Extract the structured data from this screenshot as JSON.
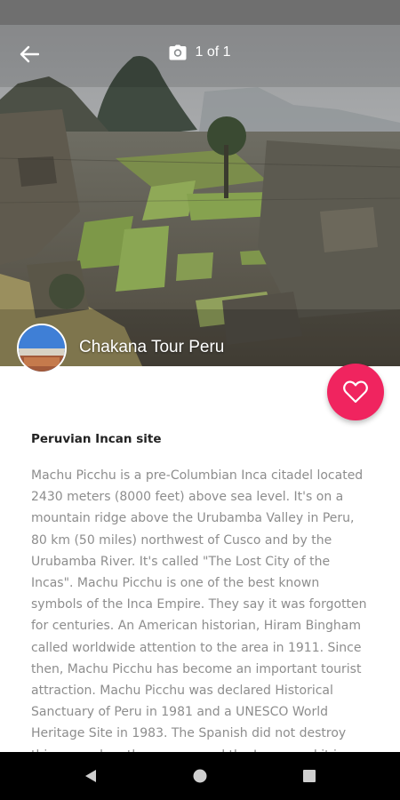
{
  "header": {
    "back_icon": "arrow-left-icon",
    "camera_icon": "camera-icon",
    "photo_counter": "1 of 1"
  },
  "provider": {
    "name": "Chakana Tour Peru"
  },
  "favorite": {
    "icon": "heart-outline-icon",
    "color": "#f0245f"
  },
  "content": {
    "subtitle": "Peruvian Incan site",
    "description": "Machu Picchu is a pre-Columbian Inca citadel located 2430 meters (8000 feet) above sea level. It's on a mountain ridge above the Urubamba Valley in Peru, 80 km (50 miles) northwest of Cusco and by the Urubamba River. It's called \"The Lost City of the Incas\". Machu Picchu is one of the best known symbols of the Inca Empire. They say it was forgotten for centuries. An American historian, Hiram Bingham called worldwide attention to the area in 1911. Since then, Machu Picchu has become an important tourist attraction. Machu Picchu was declared Historical Sanctuary of Peru in 1981 and a UNESCO World Heritage Site in 1983. The Spanish did not destroy this area when they conquered the Incas, and it is possibly the reason it remained"
  },
  "navigation": {
    "back_icon": "triangle-back-icon",
    "home_icon": "circle-home-icon",
    "recents_icon": "square-recents-icon"
  }
}
